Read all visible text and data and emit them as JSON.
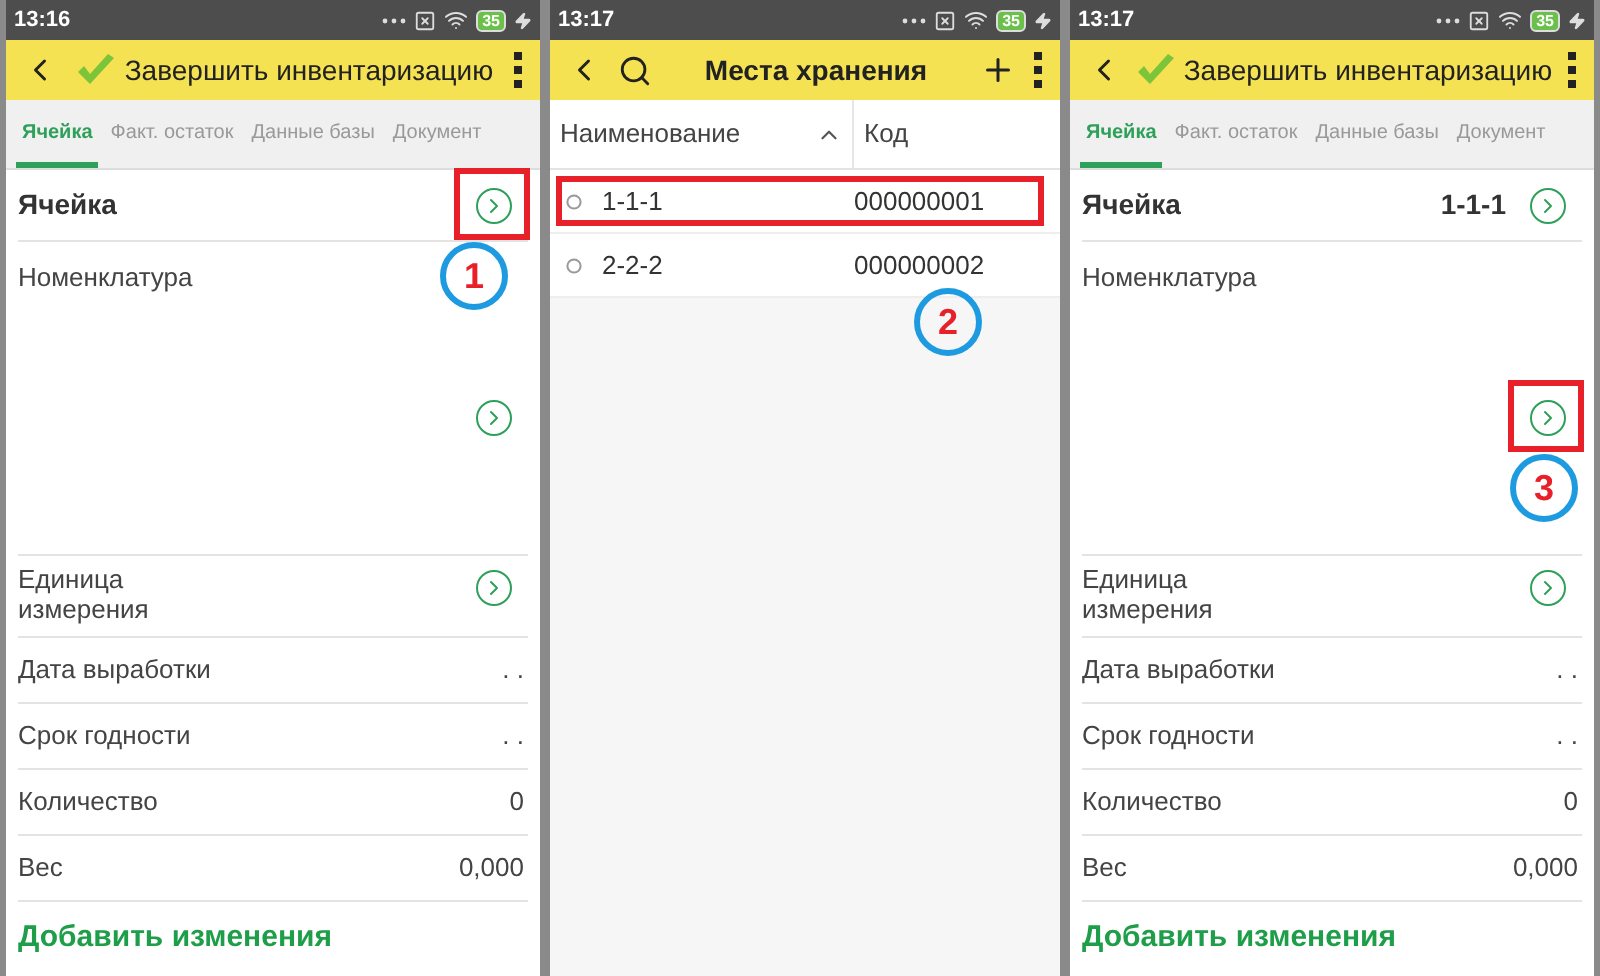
{
  "screens": [
    {
      "kind": "form",
      "status_bar": {
        "time": "13:16",
        "battery": "35"
      },
      "header": {
        "title": "Завершить инвентаризацию"
      },
      "tabs": [
        {
          "label": "Ячейка",
          "selected": true
        },
        {
          "label": "Факт. остаток",
          "selected": false
        },
        {
          "label": "Данные базы",
          "selected": false
        },
        {
          "label": "Документ",
          "selected": false
        }
      ],
      "fields": [
        {
          "kind": "title",
          "label": "Ячейка",
          "arrow": true,
          "highlighted": true,
          "callout": "1"
        },
        {
          "kind": "tall",
          "label": "Номенклатура",
          "arrow": true,
          "highlighted": false
        },
        {
          "kind": "ref",
          "label": "Единица измерения",
          "arrow": true,
          "highlighted": false
        },
        {
          "kind": "value",
          "label": "Дата выработки",
          "value": ". .",
          "arrow": false,
          "highlighted": false
        },
        {
          "kind": "value",
          "label": "Срок годности",
          "value": ". .",
          "arrow": false,
          "highlighted": false
        },
        {
          "kind": "value",
          "label": "Количество",
          "value": "0",
          "arrow": false,
          "highlighted": false
        },
        {
          "kind": "value",
          "label": "Вес",
          "value": "0,000",
          "arrow": false,
          "highlighted": false
        }
      ],
      "action": "Добавить изменения"
    },
    {
      "kind": "list",
      "status_bar": {
        "time": "13:17",
        "battery": "35"
      },
      "header": {
        "title": "Места хранения"
      },
      "columns": [
        {
          "label": "Наименование",
          "sorted": true
        },
        {
          "label": "Код",
          "sorted": false
        }
      ],
      "rows": [
        {
          "name": "1-1-1",
          "code": "000000001",
          "highlighted": true
        },
        {
          "name": "2-2-2",
          "code": "000000002",
          "highlighted": false,
          "callout": "2"
        }
      ]
    },
    {
      "kind": "form",
      "status_bar": {
        "time": "13:17",
        "battery": "35"
      },
      "header": {
        "title": "Завершить инвентаризацию"
      },
      "tabs": [
        {
          "label": "Ячейка",
          "selected": true
        },
        {
          "label": "Факт. остаток",
          "selected": false
        },
        {
          "label": "Данные базы",
          "selected": false
        },
        {
          "label": "Документ",
          "selected": false
        }
      ],
      "fields": [
        {
          "kind": "title",
          "label": "Ячейка",
          "value": "1-1-1",
          "arrow": true,
          "highlighted": false
        },
        {
          "kind": "tall",
          "label": "Номенклатура",
          "arrow": true,
          "highlighted": true,
          "callout": "3"
        },
        {
          "kind": "ref",
          "label": "Единица измерения",
          "arrow": true,
          "highlighted": false
        },
        {
          "kind": "value",
          "label": "Дата выработки",
          "value": ". .",
          "arrow": false,
          "highlighted": false
        },
        {
          "kind": "value",
          "label": "Срок годности",
          "value": ". .",
          "arrow": false,
          "highlighted": false
        },
        {
          "kind": "value",
          "label": "Количество",
          "value": "0",
          "arrow": false,
          "highlighted": false
        },
        {
          "kind": "value",
          "label": "Вес",
          "value": "0,000",
          "arrow": false,
          "highlighted": false
        }
      ],
      "action": "Добавить изменения"
    }
  ]
}
